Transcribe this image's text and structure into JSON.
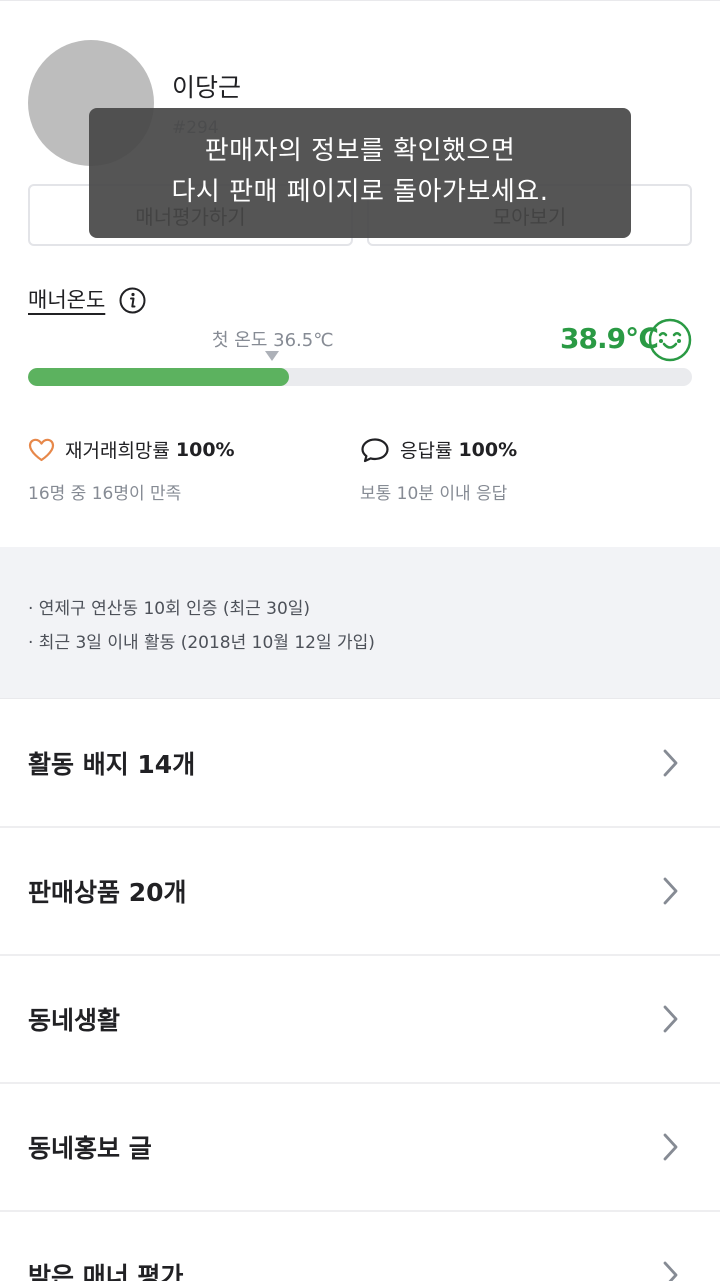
{
  "profile": {
    "nickname": "이당근",
    "user_id": "#294",
    "buttons": {
      "left_label": "매너평가하기",
      "right_label": "모아보기"
    }
  },
  "toast": {
    "line1": "판매자의 정보를 확인했으면",
    "line2": "다시 판매 페이지로 돌아가보세요."
  },
  "manner": {
    "label": "매너온도",
    "first_temp_label": "첫 온도 36.5℃",
    "temp_value": "38.9℃",
    "temp_numeric": 38.9,
    "bar_fill_fraction": 0.393,
    "accent_color": "#2a9a44",
    "bar_color": "#5cb25f"
  },
  "stats": {
    "rehire_label": "재거래희망률",
    "rehire_value": "100%",
    "rehire_sub": "16명 중 16명이 만족",
    "response_label": "응답률",
    "response_value": "100%",
    "response_sub": "보통 10분 이내 응답"
  },
  "info": [
    "· 연제구 연산동 10회 인증 (최근 30일)",
    "· 최근 3일 이내 활동 (2018년 10월 12일 가입)"
  ],
  "menu": [
    {
      "label": "활동 배지 14개"
    },
    {
      "label": "판매상품 20개"
    },
    {
      "label": "동네생활"
    },
    {
      "label": "동네홍보 글"
    },
    {
      "label": "받은 매너 평가"
    }
  ],
  "icons": {
    "info": "info-icon",
    "smile": "smile-face-icon",
    "heart": "heart-icon",
    "chat": "chat-bubble-icon",
    "chevron": "chevron-right-icon"
  }
}
